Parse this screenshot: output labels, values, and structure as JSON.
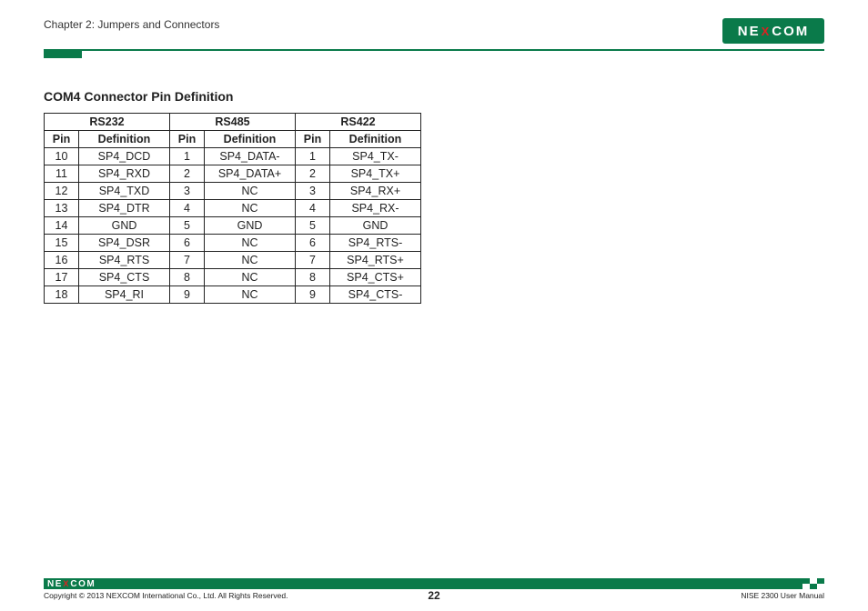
{
  "header": {
    "chapter": "Chapter 2: Jumpers and Connectors",
    "logo_text_pre": "NE",
    "logo_text_x": "X",
    "logo_text_post": "COM"
  },
  "section": {
    "title": "COM4 Connector Pin Definition"
  },
  "table": {
    "group_headers": [
      "RS232",
      "RS485",
      "RS422"
    ],
    "sub_headers": [
      "Pin",
      "Definition",
      "Pin",
      "Definition",
      "Pin",
      "Definition"
    ],
    "rows": [
      [
        "10",
        "SP4_DCD",
        "1",
        "SP4_DATA-",
        "1",
        "SP4_TX-"
      ],
      [
        "11",
        "SP4_RXD",
        "2",
        "SP4_DATA+",
        "2",
        "SP4_TX+"
      ],
      [
        "12",
        "SP4_TXD",
        "3",
        "NC",
        "3",
        "SP4_RX+"
      ],
      [
        "13",
        "SP4_DTR",
        "4",
        "NC",
        "4",
        "SP4_RX-"
      ],
      [
        "14",
        "GND",
        "5",
        "GND",
        "5",
        "GND"
      ],
      [
        "15",
        "SP4_DSR",
        "6",
        "NC",
        "6",
        "SP4_RTS-"
      ],
      [
        "16",
        "SP4_RTS",
        "7",
        "NC",
        "7",
        "SP4_RTS+"
      ],
      [
        "17",
        "SP4_CTS",
        "8",
        "NC",
        "8",
        "SP4_CTS+"
      ],
      [
        "18",
        "SP4_RI",
        "9",
        "NC",
        "9",
        "SP4_CTS-"
      ]
    ]
  },
  "footer": {
    "copyright": "Copyright © 2013 NEXCOM International Co., Ltd. All Rights Reserved.",
    "page_number": "22",
    "doc_ref": "NISE 2300 User Manual",
    "logo_text_pre": "NE",
    "logo_text_x": "X",
    "logo_text_post": "COM"
  }
}
